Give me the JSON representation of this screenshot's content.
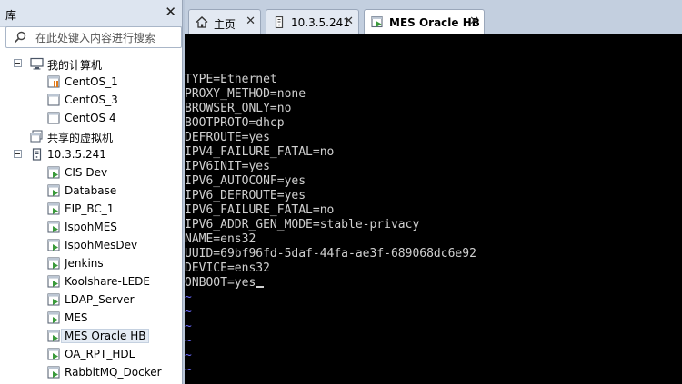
{
  "library": {
    "title": "库",
    "close_glyph": "✕",
    "search_placeholder": "在此处键入内容进行搜索"
  },
  "tree": [
    {
      "label": "我的计算机",
      "icon": "computer-icon",
      "expandable": true
    },
    {
      "label": "CentOS_1",
      "icon": "vm-running-icon"
    },
    {
      "label": "CentOS_3",
      "icon": "vm-icon"
    },
    {
      "label": "CentOS 4",
      "icon": "vm-icon"
    },
    {
      "label": "共享的虚拟机",
      "icon": "shared-vms-icon"
    },
    {
      "label": "10.3.5.241",
      "icon": "server-icon",
      "expandable": true
    },
    {
      "label": "CIS Dev",
      "icon": "remote-vm-icon"
    },
    {
      "label": "Database",
      "icon": "remote-vm-icon"
    },
    {
      "label": "EIP_BC_1",
      "icon": "remote-vm-icon"
    },
    {
      "label": "IspohMES",
      "icon": "remote-vm-icon"
    },
    {
      "label": "IspohMesDev",
      "icon": "remote-vm-icon"
    },
    {
      "label": "Jenkins",
      "icon": "remote-vm-icon"
    },
    {
      "label": "Koolshare-LEDE",
      "icon": "remote-vm-icon"
    },
    {
      "label": "LDAP_Server",
      "icon": "remote-vm-icon"
    },
    {
      "label": "MES",
      "icon": "remote-vm-icon"
    },
    {
      "label": "MES Oracle HB",
      "icon": "remote-vm-icon",
      "selected": true
    },
    {
      "label": "OA_RPT_HDL",
      "icon": "remote-vm-icon"
    },
    {
      "label": "RabbitMQ_Docker",
      "icon": "remote-vm-icon"
    }
  ],
  "tabs": [
    {
      "label": "主页",
      "icon": "home-icon",
      "active": false
    },
    {
      "label": "10.3.5.241",
      "icon": "server-tab-icon",
      "active": false
    },
    {
      "label": "MES Oracle HB",
      "icon": "vm-tab-icon",
      "active": true
    }
  ],
  "tab_close_glyph": "✕",
  "console": {
    "lines": [
      "TYPE=Ethernet",
      "PROXY_METHOD=none",
      "BROWSER_ONLY=no",
      "BOOTPROTO=dhcp",
      "DEFROUTE=yes",
      "IPV4_FAILURE_FATAL=no",
      "IPV6INIT=yes",
      "IPV6_AUTOCONF=yes",
      "IPV6_DEFROUTE=yes",
      "IPV6_FAILURE_FATAL=no",
      "IPV6_ADDR_GEN_MODE=stable-privacy",
      "NAME=ens32",
      "UUID=69bf96fd-5daf-44fa-ae3f-689068dc6e92",
      "DEVICE=ens32",
      "ONBOOT=yes"
    ],
    "tilde_lines": [
      "~",
      "~",
      "~",
      "~",
      "~",
      "~"
    ],
    "text_color": "#d0d0d0",
    "tilde_color": "#6b6bff"
  },
  "colors": {
    "accent": "#3c7fd0",
    "vm_icon_green": "#3a9a3a",
    "vm_running_orange": "#e07a1a"
  }
}
